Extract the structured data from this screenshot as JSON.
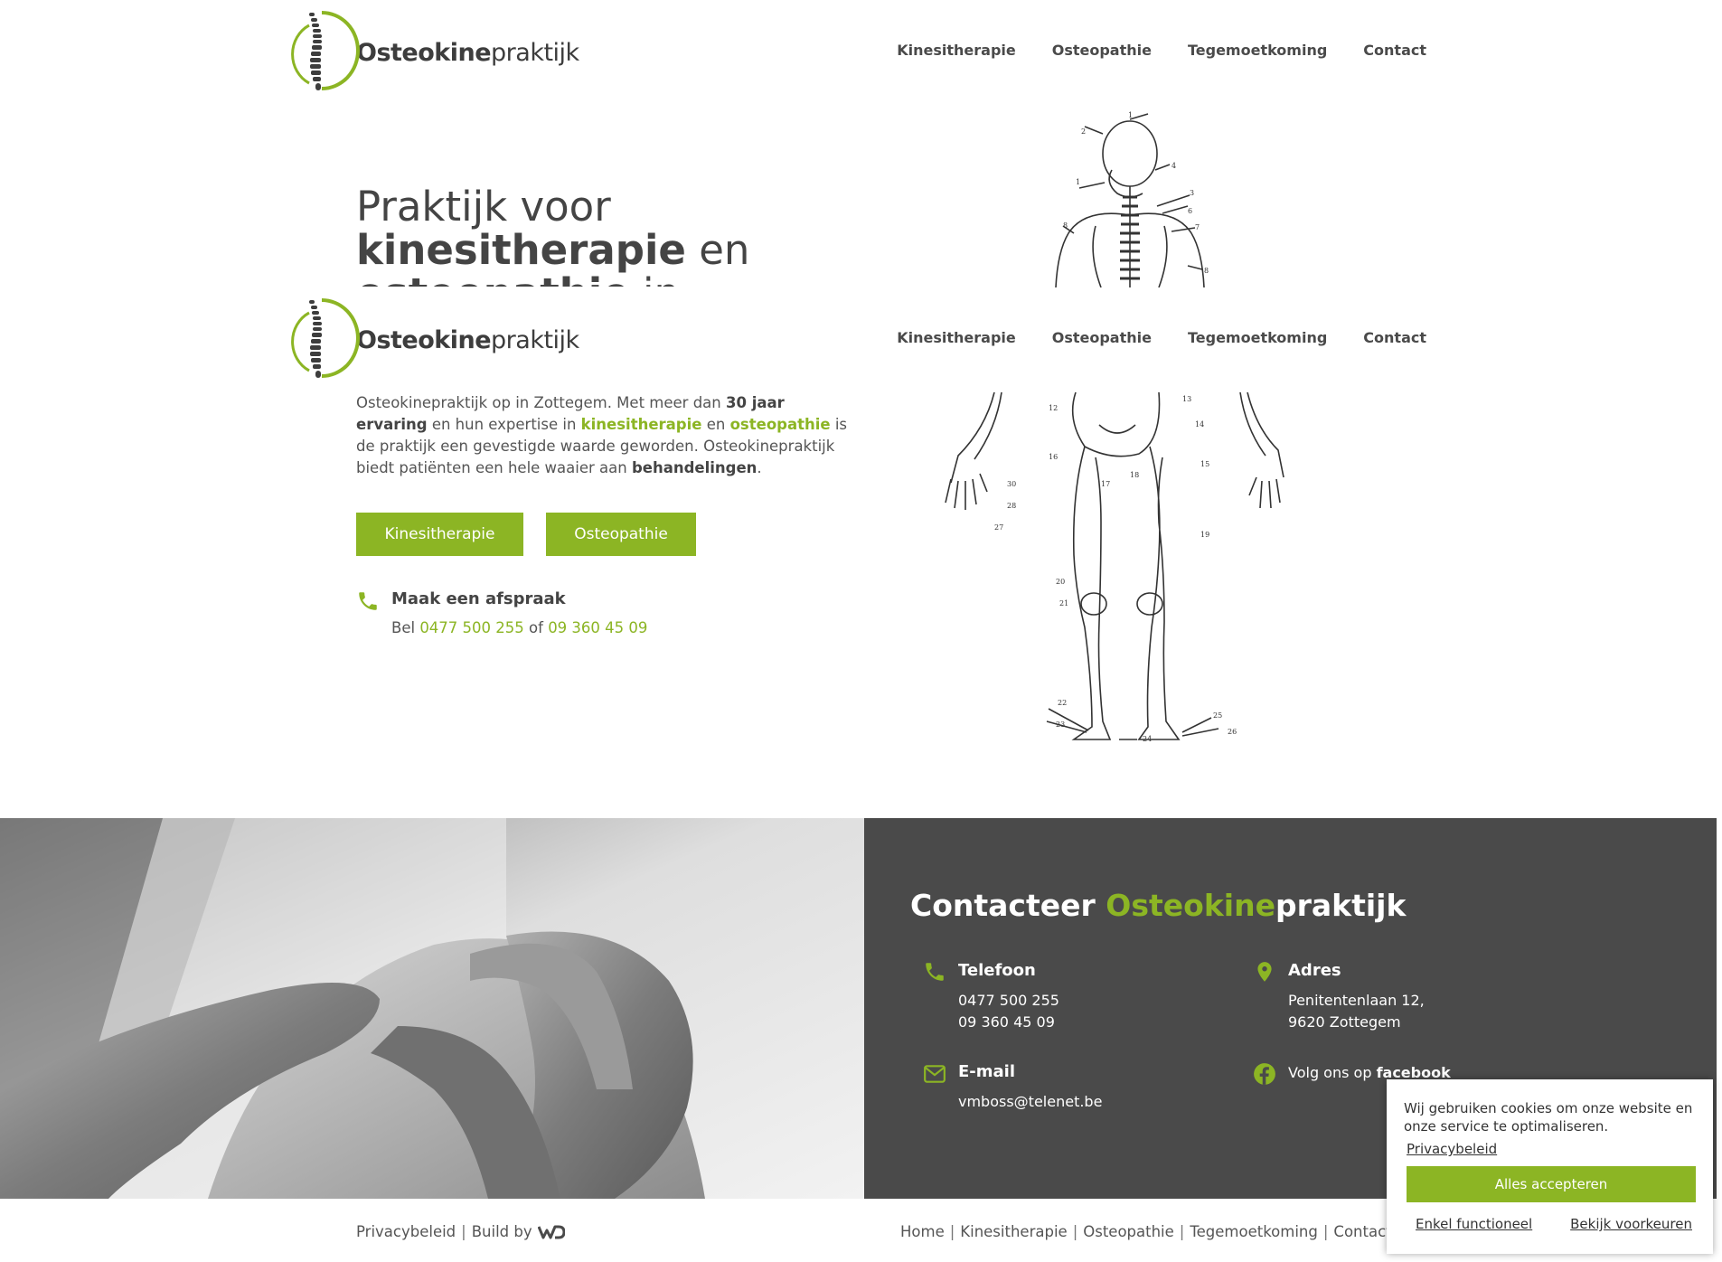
{
  "colors": {
    "accent": "#8cb524",
    "dark_panel": "#4a4a4a",
    "text": "#4a4a4a"
  },
  "brand": {
    "logo_bold": "Osteokine",
    "logo_light": "praktijk"
  },
  "nav": [
    "Kinesitherapie",
    "Osteopathie",
    "Tegemoetkoming",
    "Contact"
  ],
  "hero": {
    "line1": "Praktijk voor",
    "line2_bold": "kinesitherapie",
    "line2_rest": " en",
    "line3_bold": "osteopathie",
    "line3_rest": " in Zottegem"
  },
  "intro": {
    "p1": "Osteokinepraktijk op in Zottegem. Met meer dan ",
    "b1": "30 jaar ervaring",
    "p2": " en hun expertise in ",
    "g1": "kinesitherapie",
    "p3": " en ",
    "g2": "osteopathie",
    "p4": " is de praktijk een gevestigde waarde geworden. Osteokinepraktijk biedt patiënten een hele waaier aan ",
    "b2": "behandelingen",
    "p5": "."
  },
  "buttons": {
    "kine": "Kinesitherapie",
    "osteo": "Osteopathie"
  },
  "appointment": {
    "icon": "phone-icon",
    "title": "Maak een afspraak",
    "prefix": "Bel ",
    "phone1": "0477 500 255",
    "middle": " of ",
    "phone2": "09 360 45 09"
  },
  "contact": {
    "title_a": "Contacteer ",
    "title_b": "Osteokine",
    "title_c": "praktijk",
    "phone_head": "Telefoon",
    "phone1": "0477 500 255",
    "phone2": "09 360 45 09",
    "address_head": "Adres",
    "address1": "Penitentenlaan 12,",
    "address2": "9620 Zottegem",
    "email_head": "E-mail",
    "email": "vmboss@telenet.be",
    "facebook_pre": "Volg ons op ",
    "facebook_link": "facebook"
  },
  "footer": {
    "privacy": "Privacybeleid",
    "build_by": "Build by",
    "links": [
      "Home",
      "Kinesitherapie",
      "Osteopathie",
      "Tegemoetkoming",
      "Contact"
    ]
  },
  "cookie": {
    "text": "Wij gebruiken cookies om onze website en onze service te optimaliseren.",
    "privacy": "Privacybeleid",
    "accept": "Alles accepteren",
    "functional": "Enkel functioneel",
    "preferences": "Bekijk voorkeuren"
  }
}
